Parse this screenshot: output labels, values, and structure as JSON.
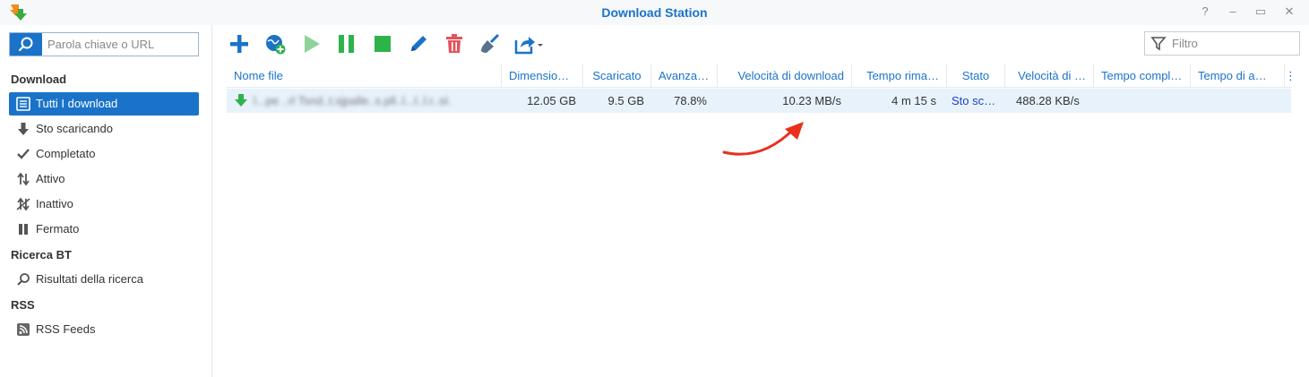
{
  "window": {
    "title": "Download Station",
    "controls": {
      "help": "?",
      "minimize": "–",
      "maximize": "▭",
      "close": "✕"
    }
  },
  "sidebar": {
    "search_placeholder": "Parola chiave o URL",
    "sections": [
      {
        "label": "Download"
      },
      {
        "label": "Ricerca BT"
      },
      {
        "label": "RSS"
      }
    ],
    "items": [
      {
        "label": "Tutti I download",
        "icon": "list-icon",
        "selected": true
      },
      {
        "label": "Sto scaricando",
        "icon": "arrow-down-icon"
      },
      {
        "label": "Completato",
        "icon": "check-icon"
      },
      {
        "label": "Attivo",
        "icon": "up-down-arrows-icon"
      },
      {
        "label": "Inattivo",
        "icon": "inactive-icon"
      },
      {
        "label": "Fermato",
        "icon": "pause-icon"
      },
      {
        "label": "Risultati della ricerca",
        "icon": "search-icon"
      },
      {
        "label": "RSS Feeds",
        "icon": "rss-icon"
      }
    ]
  },
  "toolbar": {
    "buttons": [
      "add-icon",
      "add-url-icon",
      "play-icon",
      "pause-icon",
      "stop-icon",
      "edit-icon",
      "delete-icon",
      "clean-icon",
      "share-icon"
    ],
    "filter_placeholder": "Filtro"
  },
  "grid": {
    "columns": [
      "Nome file",
      "Dimensio…",
      "Scaricato",
      "Avanza…",
      "Velocità di download",
      "Tempo rima…",
      "Stato",
      "Velocità di …",
      "Tempo compl…",
      "Tempo di a…"
    ],
    "rows": [
      {
        "name": "l...pe ..rl Tsnd..t.sjpalle..s.pll..l...l..l.r..sI.",
        "size": "12.05 GB",
        "downloaded": "9.5 GB",
        "progress": "78.8%",
        "download_speed": "10.23 MB/s",
        "time_remaining": "4 m 15 s",
        "status": "Sto sc…",
        "upload_speed": "488.28 KB/s",
        "time_completed": "",
        "time_active": ""
      }
    ]
  },
  "colors": {
    "accent": "#1a73c9",
    "selected_row": "#e8f2fb",
    "green": "#2db34a",
    "annotation": "#e8301c"
  }
}
